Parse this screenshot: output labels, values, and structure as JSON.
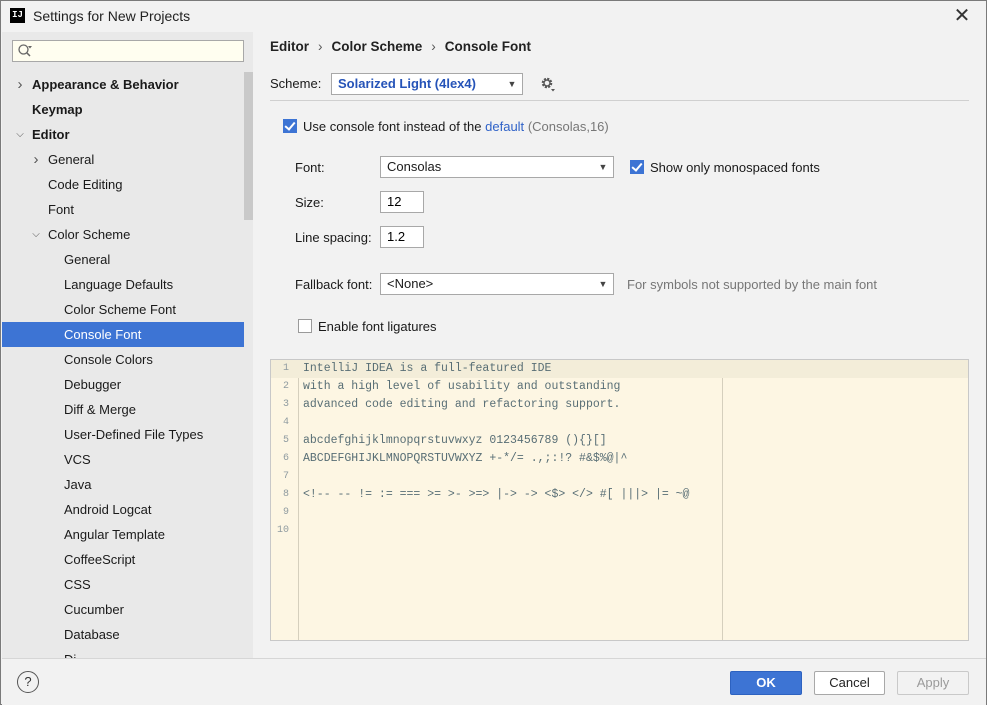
{
  "window": {
    "title": "Settings for New Projects",
    "app_icon": "IJ",
    "close_glyph": "✕"
  },
  "search": {
    "placeholder": ""
  },
  "sidebar": {
    "items": [
      {
        "label": "Appearance & Behavior",
        "level": 0,
        "expandable": true,
        "expanded": false,
        "bold": true
      },
      {
        "label": "Keymap",
        "level": 0,
        "expandable": false,
        "bold": true
      },
      {
        "label": "Editor",
        "level": 0,
        "expandable": true,
        "expanded": true,
        "bold": true
      },
      {
        "label": "General",
        "level": 1,
        "expandable": true,
        "expanded": false
      },
      {
        "label": "Code Editing",
        "level": 1,
        "expandable": false
      },
      {
        "label": "Font",
        "level": 1,
        "expandable": false
      },
      {
        "label": "Color Scheme",
        "level": 1,
        "expandable": true,
        "expanded": true
      },
      {
        "label": "General",
        "level": 2,
        "expandable": false
      },
      {
        "label": "Language Defaults",
        "level": 2,
        "expandable": false
      },
      {
        "label": "Color Scheme Font",
        "level": 2,
        "expandable": false
      },
      {
        "label": "Console Font",
        "level": 2,
        "expandable": false,
        "selected": true
      },
      {
        "label": "Console Colors",
        "level": 2,
        "expandable": false
      },
      {
        "label": "Debugger",
        "level": 2,
        "expandable": false
      },
      {
        "label": "Diff & Merge",
        "level": 2,
        "expandable": false
      },
      {
        "label": "User-Defined File Types",
        "level": 2,
        "expandable": false
      },
      {
        "label": "VCS",
        "level": 2,
        "expandable": false
      },
      {
        "label": "Java",
        "level": 2,
        "expandable": false
      },
      {
        "label": "Android Logcat",
        "level": 2,
        "expandable": false
      },
      {
        "label": "Angular Template",
        "level": 2,
        "expandable": false
      },
      {
        "label": "CoffeeScript",
        "level": 2,
        "expandable": false
      },
      {
        "label": "CSS",
        "level": 2,
        "expandable": false
      },
      {
        "label": "Cucumber",
        "level": 2,
        "expandable": false
      },
      {
        "label": "Database",
        "level": 2,
        "expandable": false
      },
      {
        "label": "Di...",
        "level": 2,
        "expandable": false
      }
    ]
  },
  "breadcrumb": {
    "parts": [
      "Editor",
      "Color Scheme",
      "Console Font"
    ],
    "separator": "›"
  },
  "scheme": {
    "label": "Scheme:",
    "value": "Solarized Light (4lex4)",
    "gear_icon": "gear-icon"
  },
  "use_console_font": {
    "checked": true,
    "label": "Use console font instead of the",
    "link": "default",
    "default_value": "(Consolas,16)"
  },
  "font": {
    "label": "Font:",
    "value": "Consolas"
  },
  "monospaced": {
    "checked": true,
    "label": "Show only monospaced fonts"
  },
  "size": {
    "label": "Size:",
    "value": "12"
  },
  "line_spacing": {
    "label": "Line spacing:",
    "value": "1.2"
  },
  "fallback": {
    "label": "Fallback font:",
    "value": "<None>",
    "hint": "For symbols not supported by the main font"
  },
  "ligatures": {
    "checked": false,
    "label": "Enable font ligatures"
  },
  "preview": {
    "lines": [
      "IntelliJ IDEA is a full-featured IDE",
      "with a high level of usability and outstanding",
      "advanced code editing and refactoring support.",
      "",
      "abcdefghijklmnopqrstuvwxyz 0123456789 (){}[]",
      "ABCDEFGHIJKLMNOPQRSTUVWXYZ +-*/= .,;:!? #&$%@|^",
      "",
      "<!-- -- != := === >= >- >=> |-> -> <$> </> #[ |||> |= ~@",
      "",
      ""
    ]
  },
  "buttons": {
    "help": "?",
    "ok": "OK",
    "cancel": "Cancel",
    "apply": "Apply"
  },
  "colors": {
    "accent": "#3d74d4",
    "preview_bg": "#fdf6e3",
    "scheme_text": "#2553b8",
    "link": "#2f62c8"
  }
}
